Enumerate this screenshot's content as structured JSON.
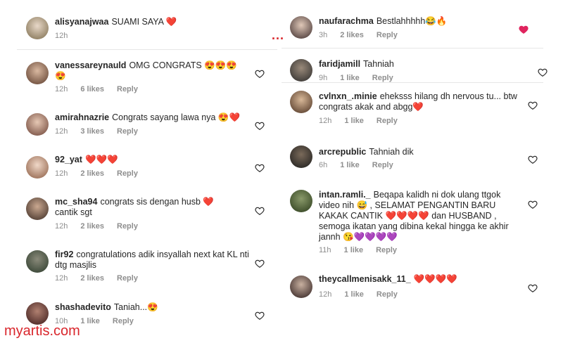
{
  "left": [
    {
      "user": "alisyanajwaa",
      "text": "SUAMI SAYA ❤️",
      "time": "12h",
      "likes": "",
      "reply": ""
    },
    {
      "user": "vanessareynauld",
      "text": "OMG CONGRATS 😍😍😍😍",
      "time": "12h",
      "likes": "6 likes",
      "reply": "Reply"
    },
    {
      "user": "amirahnazrie",
      "text": "Congrats sayang lawa nya 😍❤️",
      "time": "12h",
      "likes": "3 likes",
      "reply": "Reply"
    },
    {
      "user": "92_yat",
      "text": "❤️❤️❤️",
      "time": "12h",
      "likes": "2 likes",
      "reply": "Reply"
    },
    {
      "user": "mc_sha94",
      "text": "congrats sis dengan husb ❤️ cantik sgt",
      "time": "12h",
      "likes": "2 likes",
      "reply": "Reply"
    },
    {
      "user": "fir92",
      "text": "congratulations adik insyallah next kat KL nti dtg masjlis",
      "time": "12h",
      "likes": "2 likes",
      "reply": "Reply"
    },
    {
      "user": "shashadevito",
      "text": "Taniah...😍",
      "time": "10h",
      "likes": "1 like",
      "reply": "Reply"
    }
  ],
  "right": [
    {
      "user": "naufarachma",
      "text": "Bestlahhhhh😂🔥",
      "time": "3h",
      "likes": "2 likes",
      "reply": "Reply"
    },
    {
      "user": "faridjamill",
      "text": "Tahniah",
      "time": "9h",
      "likes": "1 like",
      "reply": "Reply"
    },
    {
      "user": "cvlnxn_.minie",
      "text": "eheksss hilang dh nervous tu... btw congrats akak and abgg❤️",
      "time": "12h",
      "likes": "1 like",
      "reply": "Reply"
    },
    {
      "user": "arcrepublic",
      "text": "Tahniah dik",
      "time": "6h",
      "likes": "1 like",
      "reply": "Reply"
    },
    {
      "user": "intan.ramli._",
      "text": "Beqapa kalidh ni dok ulang ttgok video nih 😅 , SELAMAT PENGANTIN BARU KAKAK CANTIK ❤️❤️❤️❤️ dan HUSBAND , semoga ikatan yang dibina kekal hingga ke akhir jannh 😘💜💜💜💜",
      "time": "11h",
      "likes": "1 like",
      "reply": "Reply"
    },
    {
      "user": "theycallmenisakk_11_",
      "text": "❤️❤️❤️❤️",
      "time": "12h",
      "likes": "1 like",
      "reply": "Reply"
    }
  ],
  "watermark": "myartis.com",
  "dots": "...",
  "colors": {
    "heart": "#e0245e",
    "meta": "#8e8e8e",
    "watermark": "#d9262c"
  }
}
